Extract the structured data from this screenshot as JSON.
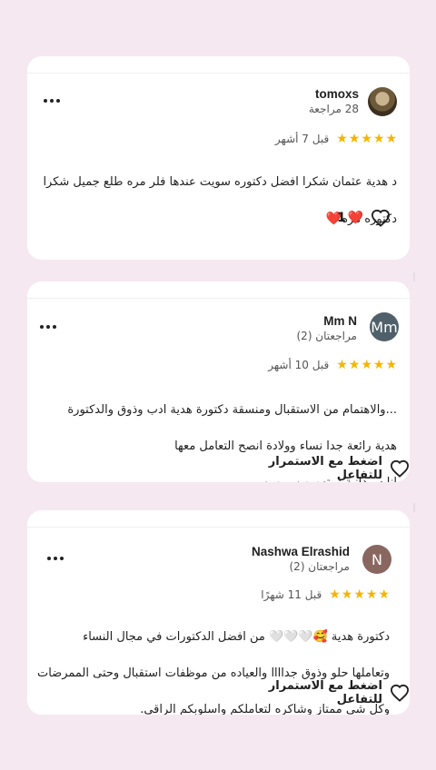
{
  "reviews": [
    {
      "name": "tomoxs",
      "review_count": "28 مراجعة",
      "avatar": "photo",
      "avatar_letter": "",
      "avatar_color": "#6e5a3a",
      "rating": 5,
      "time": "قبل 7 أشهر",
      "text_line1": "د هدية عثمان شكرا افضل دكتوره سويت عندها فلر مره طلع جميل شكرا",
      "text_line2": "دكتوره مره",
      "text_emoji": "❤️",
      "like_count": "1",
      "like_emoji": "❤️"
    },
    {
      "name": "Mm N",
      "review_count": "مراجعتان (2)",
      "avatar_letter": "Mm",
      "avatar_color": "#50606a",
      "rating": 5,
      "time": "قبل 10 أشهر",
      "text_line1": "...والاهتمام من الاستقبال ومنسقة دكتورة هدية ادب وذوق والدكتورة",
      "text_line2": "هدية  رائعة جدا  نساء وولادة انصح التعامل معها",
      "text_line3": "انا سودانية زرتهم من يومين",
      "action_label": "اضغط مع الاستمرار للتفاعل"
    },
    {
      "name": "Nashwa Elrashid",
      "review_count": "مراجعتان (2)",
      "avatar_letter": "N",
      "avatar_color": "#8a6660",
      "rating": 5,
      "time": "قبل 11 شهرًا",
      "text_line1": "دكتورة هدية 🥰🤍🤍🤍 من افضل الدكتورات في مجال النساء",
      "text_line2": "وتعاملها حلو وذوق جداااا والعياده من موظفات استقبال وحتى الممرضات",
      "text_line3": "وكل شي ممتاز وشاكره لتعاملكم واسلوبكم الراقي.",
      "action_label": "اضغط مع الاستمرار للتفاعل"
    }
  ],
  "colors": {
    "background": "#f6e8f1",
    "star": "#f6b400",
    "heart": "#e0202a"
  }
}
